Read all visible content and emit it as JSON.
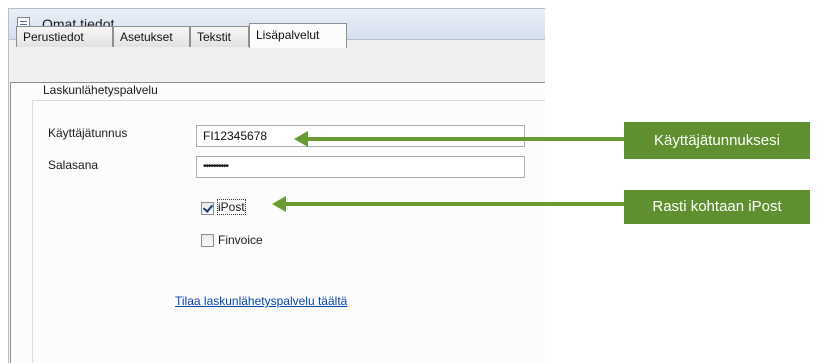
{
  "window": {
    "title": "Omat tiedot"
  },
  "tabs": [
    {
      "label": "Perustiedot"
    },
    {
      "label": "Asetukset"
    },
    {
      "label": "Tekstit"
    },
    {
      "label": "Lisäpalvelut",
      "active": true
    }
  ],
  "group": {
    "legend": "Laskunlähetyspalvelu",
    "username_label": "Käyttäjätunnus",
    "username_value": "FI12345678",
    "password_label": "Salasana",
    "password_value": "••••••••••",
    "checkboxes": [
      {
        "label": "iPost",
        "checked": true
      },
      {
        "label": "Finvoice",
        "checked": false
      }
    ],
    "link_text": "Tilaa laskunlähetyspalvelu täältä"
  },
  "callouts": [
    {
      "text": "Käyttäjätunnuksesi"
    },
    {
      "text": "Rasti kohtaan iPost"
    }
  ],
  "colors": {
    "callout_bg": "#5f8f2f",
    "arrow": "#6a9a34",
    "link": "#0645ad"
  }
}
